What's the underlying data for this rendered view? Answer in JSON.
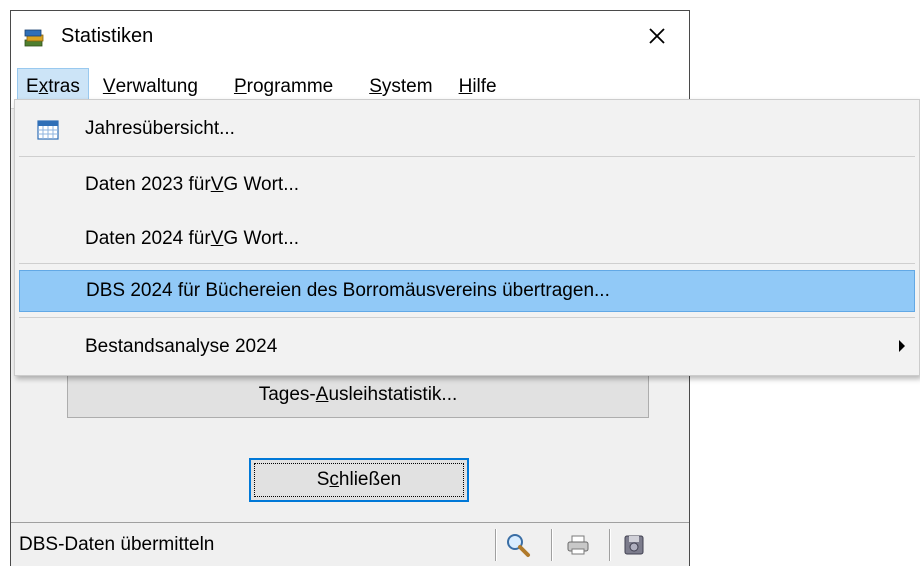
{
  "window": {
    "title": "Statistiken",
    "close_glyph": "✕"
  },
  "menubar": [
    {
      "pre": "E",
      "key": "x",
      "post": "tras"
    },
    {
      "pre": "",
      "key": "V",
      "post": "erwaltung"
    },
    {
      "pre": "",
      "key": "P",
      "post": "rogramme"
    },
    {
      "pre": "",
      "key": "S",
      "post": "ystem"
    },
    {
      "pre": "",
      "key": "H",
      "post": "ilfe"
    }
  ],
  "dropdown": {
    "item1": "Jahresübersicht...",
    "item2": {
      "pre": "Daten 2023 für ",
      "key": "V",
      "post": "G Wort..."
    },
    "item3": {
      "pre": "Daten 2024 für ",
      "key": "V",
      "post": "G Wort..."
    },
    "item4": "DBS 2024 für Büchereien des Borromäusvereins übertragen...",
    "item5": "Bestandsanalyse 2024"
  },
  "buttons": {
    "tages": {
      "pre": "Tages-",
      "key": "A",
      "post": "usleihstatistik..."
    },
    "schliessen": {
      "pre": "S",
      "key": "c",
      "post": "hließen"
    }
  },
  "status": {
    "text": "DBS-Daten übermitteln"
  },
  "icons": [
    "app-books-icon",
    "close-icon",
    "calendar-icon",
    "submenu-arrow-icon",
    "magnifier-icon",
    "printer-icon",
    "disk-icon"
  ],
  "colors": {
    "menu_highlight": "#91c9f7",
    "menubar_active": "#cce4f7",
    "default_button_border": "#0078d7"
  }
}
